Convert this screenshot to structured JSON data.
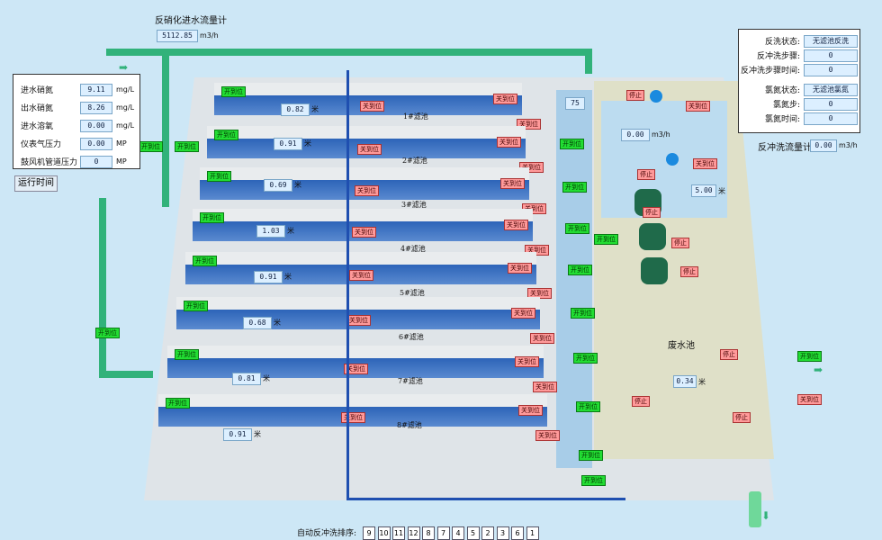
{
  "flow_meter": {
    "title": "反硝化进水流量计",
    "value": "5112.85",
    "unit": "m3/h"
  },
  "left_panel": {
    "rows": [
      {
        "label": "进水硝氮",
        "value": "9.11",
        "unit": "mg/L"
      },
      {
        "label": "出水硝氮",
        "value": "8.26",
        "unit": "mg/L"
      },
      {
        "label": "进水溶氧",
        "value": "0.00",
        "unit": "mg/L"
      },
      {
        "label": "仪表气压力",
        "value": "0.00",
        "unit": "MP"
      },
      {
        "label": "鼓风机管道压力",
        "value": "0",
        "unit": "MP"
      }
    ],
    "runtime_button": "运行时间"
  },
  "right_panel": {
    "rows": [
      {
        "label": "反洗状态:",
        "value": "无滤池反洗"
      },
      {
        "label": "反冲洗步骤:",
        "value": "0"
      },
      {
        "label": "反冲洗步骤时间:",
        "value": "0"
      },
      {
        "label": "氯氮状态:",
        "value": "无滤池氯氮"
      },
      {
        "label": "氯氮步:",
        "value": "0"
      },
      {
        "label": "氯氮时间:",
        "value": "0"
      }
    ],
    "backwash_meter_label": "反冲洗流量计",
    "backwash_meter_value": "0.00",
    "backwash_meter_unit": "m3/h"
  },
  "filters": [
    {
      "name": "1#滤池",
      "level": "0.82",
      "unit": "米"
    },
    {
      "name": "2#滤池",
      "level": "0.91",
      "unit": "米"
    },
    {
      "name": "3#滤池",
      "level": "0.69",
      "unit": "米"
    },
    {
      "name": "4#滤池",
      "level": "1.03",
      "unit": "米"
    },
    {
      "name": "5#滤池",
      "level": "0.91",
      "unit": "米"
    },
    {
      "name": "6#滤池",
      "level": "0.68",
      "unit": "米"
    },
    {
      "name": "7#滤池",
      "level": "0.81",
      "unit": "米"
    },
    {
      "name": "8#滤池",
      "level": "0.91",
      "unit": "米"
    }
  ],
  "valve_open": "开到位",
  "valve_closed": "关到位",
  "stop": "停止",
  "clear_well_value": "75",
  "tank_value": "0.00",
  "tank_unit": "m3/h",
  "tank_level": "5.00",
  "tank_level_unit": "米",
  "waste_pool": {
    "label": "废水池",
    "value": "0.34",
    "unit": "米"
  },
  "sequence": {
    "label": "自动反冲洗排序:",
    "items": [
      "9",
      "10",
      "11",
      "12",
      "8",
      "7",
      "4",
      "5",
      "2",
      "3",
      "6",
      "1"
    ]
  },
  "colors": {
    "pipe_green": "#31b27a",
    "water_blue": "#2d64b8",
    "open": "#22dd33",
    "closed": "#ff9a9a"
  }
}
